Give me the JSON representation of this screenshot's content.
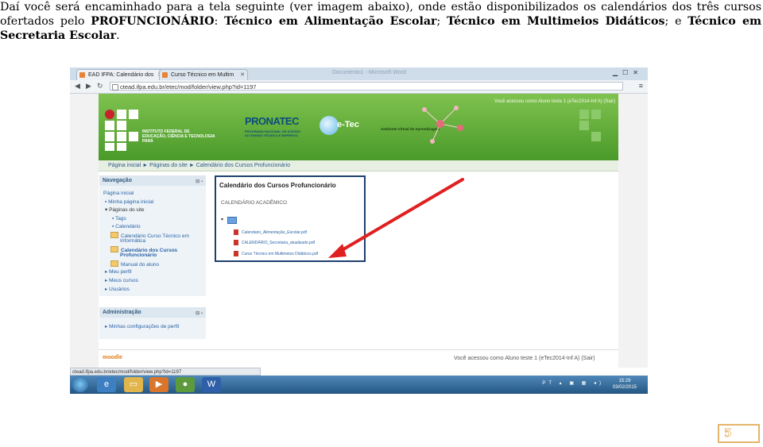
{
  "intro": {
    "part1": "Daí você será encaminhado para a tela seguinte (ver imagem abaixo), onde estão disponibilizados os calendários dos três cursos ofertados pelo ",
    "bold1": "PROFUNCIONÁRIO",
    "part2": ": ",
    "bold2": "Técnico em Alimentação Escolar",
    "part3": "; ",
    "bold3": "Técnico em Multimeios Didáticos",
    "part4": "; e ",
    "bold4": "Técnico em Secretaria Escolar",
    "part5": "."
  },
  "browser": {
    "tabs": [
      "EAD IFPA: Calendário dos",
      "Curso Técnico em Multim"
    ],
    "window_title": "Documento1 - Microsoft Word",
    "url": "ctead.ifpa.edu.br/etec/mod/folder/view.php?id=1197",
    "status_url": "ctead.ifpa.edu.br/etec/mod/folder/view.php?id=1197"
  },
  "site": {
    "login_top": "Você acessou como Aluno teste 1 (eTec2014-Inf A) (Sair)",
    "ifpa_line1": "INSTITUTO FEDERAL DE",
    "ifpa_line2": "EDUCAÇÃO, CIÊNCIA E TECNOLOGIA",
    "ifpa_line3": "PARÁ",
    "pronatec": "PRONATEC",
    "pronatec_sub1": "PROGRAMA NACIONAL DE ACESSO",
    "pronatec_sub2": "AO ENSINO TÉCNICO E EMPREGO",
    "etec": "e-Tec",
    "ava": "Ambiente Virtual de Aprendizagem",
    "breadcrumb": "Página inicial ► Páginas do site ► Calendário dos Cursos Profuncionário",
    "nav_head": "Navegação",
    "nav": {
      "home": "Página inicial",
      "my_home": "Minha página inicial",
      "site_pages": "Páginas do site",
      "tags": "Tags",
      "calendar": "Calendário",
      "course_info_a": "Calendário Curso Técnico em",
      "course_info_b": "Informática",
      "profunc_a": "Calendário dos Cursos",
      "profunc_b": "Profuncionário",
      "manual": "Manual do aluno",
      "profile": "Meu perfil",
      "courses": "Meus cursos",
      "users": "Usuários"
    },
    "admin_head": "Administração",
    "admin_item": "Minhas configurações de perfil",
    "content_title": "Calendário dos Cursos Profuncionário",
    "content_sub": "CALENDÁRIO ACADÊMICO",
    "files": [
      "Calendario_Alimentação_Escolar.pdf",
      "CALENDÁRIO_Secretaria_atualizado.pdf",
      "Curso Técnico em Multimeios Didáticos.pdf"
    ],
    "moodle": "moodle",
    "login_bottom": "Você acessou como Aluno teste 1 (eTec2014-Inf A) (Sair)"
  },
  "taskbar": {
    "lang": "PT",
    "time": "15:29",
    "date": "03/02/2015"
  },
  "page_number": "5",
  "colors": {
    "arrow": "#e02020",
    "banner": "#5aa832",
    "highlight_box": "#1e3f6e"
  }
}
